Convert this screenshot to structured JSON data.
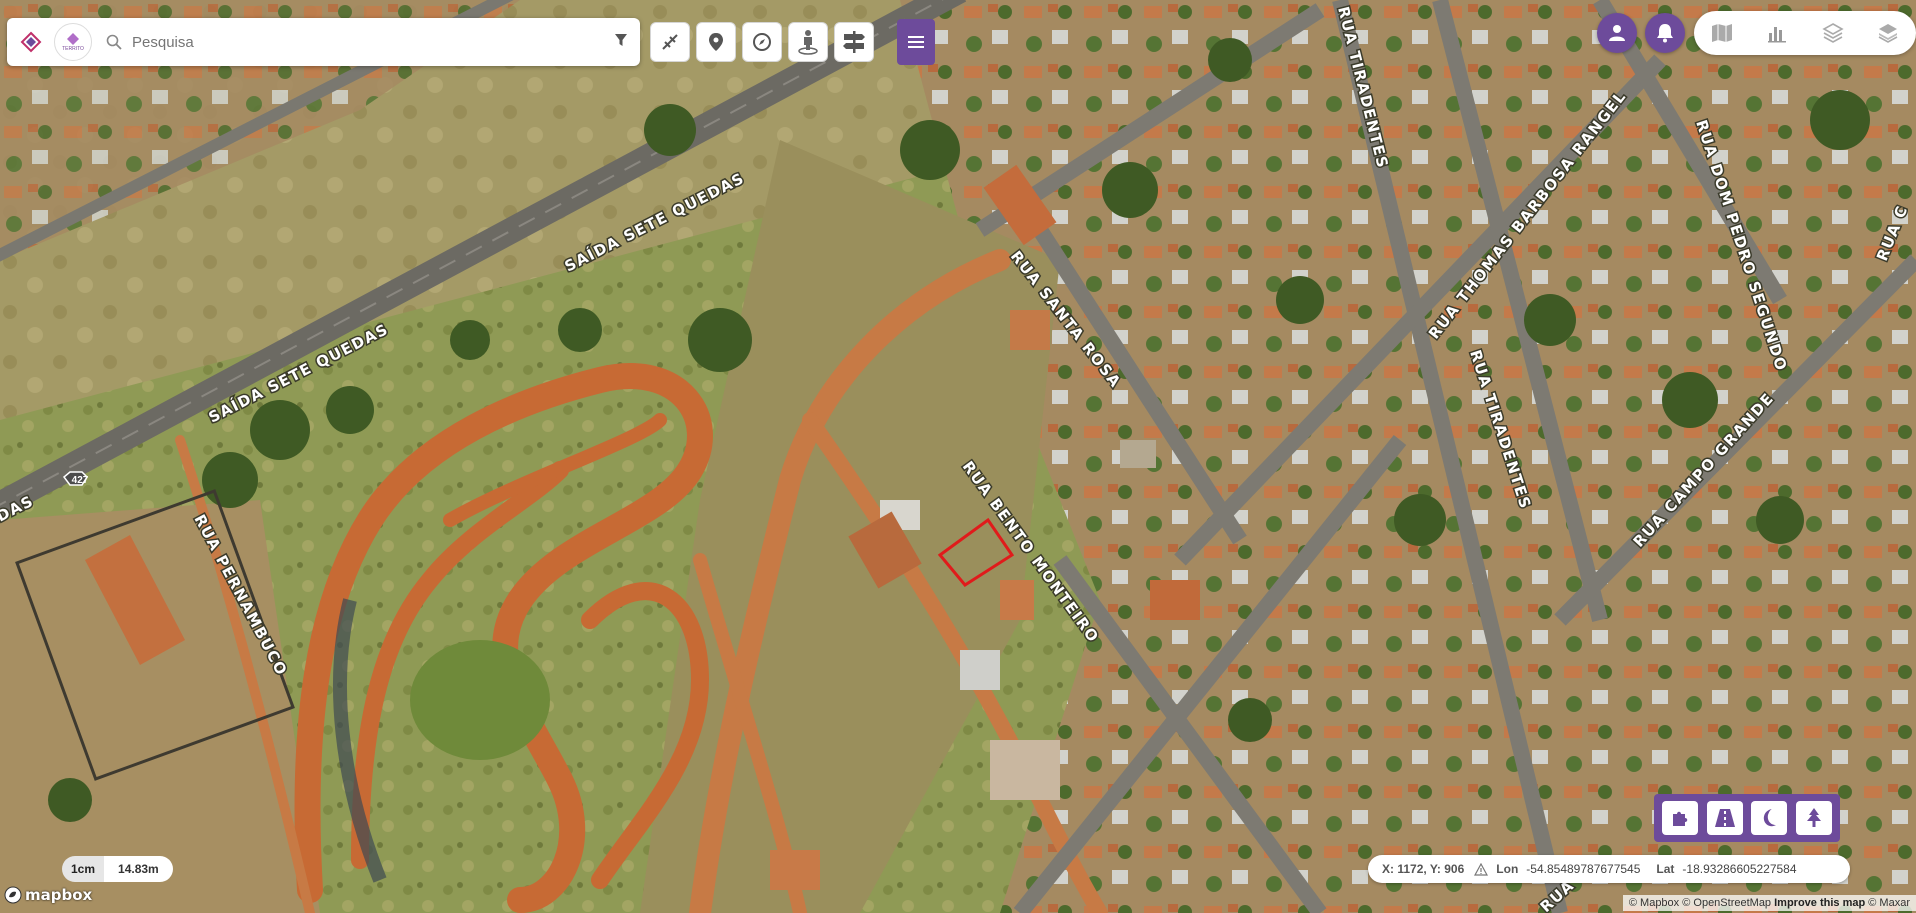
{
  "search": {
    "placeholder": "Pesquisa"
  },
  "brand": {
    "logo_text": "TERRITO"
  },
  "map": {
    "streets": [
      "SAÍDA SETE QUEDAS",
      "SAÍDA SETE QUEDAS",
      "DAS",
      "RUA PERNAMBUCO",
      "RUA SANTA ROSA",
      "RUA BENTO MONTEIRO",
      "RUA TIRADENTES",
      "RUA TIRADENTES",
      "RUA THOMAS BARBOSA RANGEL",
      "RUA DOM PEDRO SEGUNDO",
      "RUA CAMPO GRANDE",
      "RUA C",
      "RUA CU"
    ],
    "shield": "427"
  },
  "scale": {
    "unit": "1cm",
    "value": "14.83m"
  },
  "coords": {
    "xy": "X: 1172, Y: 906",
    "lon_label": "Lon",
    "lon": "-54.85489787677545",
    "lat_label": "Lat",
    "lat": "-18.93286605227584"
  },
  "attribution": {
    "mapbox": "© Mapbox",
    "osm": "© OpenStreetMap",
    "improve": "Improve this map",
    "maxar": "© Maxar"
  },
  "mapbox_logo": "mapbox",
  "colors": {
    "accent": "#6d4b9b",
    "selection": "#e01b1b"
  },
  "icons": [
    "search-icon",
    "filter-icon",
    "measure-icon",
    "pin-icon",
    "compass-icon",
    "street-view-icon",
    "signpost-icon",
    "menu-icon",
    "user-icon",
    "bell-icon",
    "map-icon",
    "chart-icon",
    "layers-outline-icon",
    "layers-filled-icon",
    "puzzle-icon",
    "road-icon",
    "moon-icon",
    "tree-icon"
  ]
}
